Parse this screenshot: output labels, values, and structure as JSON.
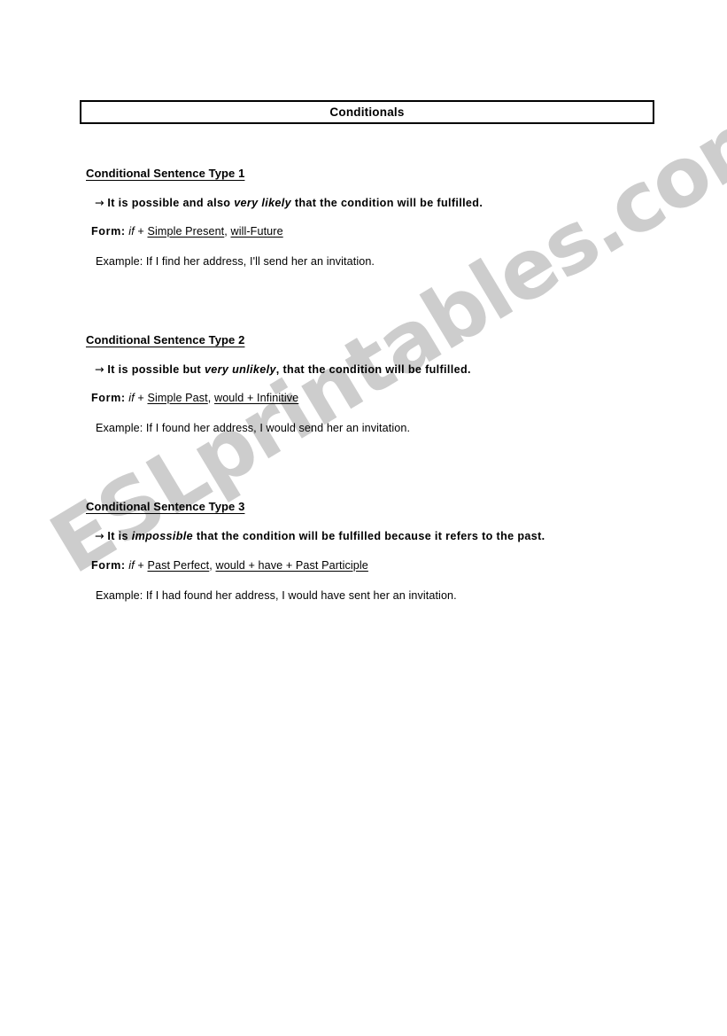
{
  "document": {
    "title": "Conditionals",
    "watermark": "ESLprintables.com",
    "watermark_color": "#cdcdcd",
    "text_color": "#000000",
    "page_background": "#ffffff"
  },
  "sections": [
    {
      "heading": "Conditional Sentence Type 1",
      "statement": {
        "arrow": "→",
        "before_emphasis": "It is possible and also ",
        "emphasis": "very likely",
        "after_emphasis": " that the condition will be fulfilled."
      },
      "form": {
        "label": "Form:",
        "if_word": "if",
        "plus": "+",
        "clause_1": "Simple Present",
        "separator": ",",
        "clause_2": "will-Future"
      },
      "example": {
        "label": "Example:",
        "sentence": "If I find her address, I'll send her an invitation."
      }
    },
    {
      "heading": "Conditional Sentence Type 2",
      "statement": {
        "arrow": "→",
        "before_emphasis": "It is possible but ",
        "emphasis": "very unlikely",
        "after_emphasis": ", that the condition will be fulfilled."
      },
      "form": {
        "label": "Form:",
        "if_word": "if",
        "plus": "+",
        "clause_1": "Simple Past",
        "separator": ",",
        "clause_2": "would + Infinitive"
      },
      "example": {
        "label": "Example:",
        "sentence": "If I found her address, I would send her an invitation."
      }
    },
    {
      "heading": "Conditional Sentence Type 3",
      "statement": {
        "arrow": "→",
        "before_emphasis": "It is ",
        "emphasis": "impossible",
        "after_emphasis": " that the condition will be fulfilled because it refers to the past."
      },
      "form": {
        "label": "Form:",
        "if_word": "if",
        "plus": "+",
        "clause_1": "Past Perfect",
        "separator": ",",
        "clause_2": "would + have + Past Participle"
      },
      "example": {
        "label": "Example:",
        "sentence": "If I had found her address, I would have sent her an invitation."
      }
    }
  ]
}
